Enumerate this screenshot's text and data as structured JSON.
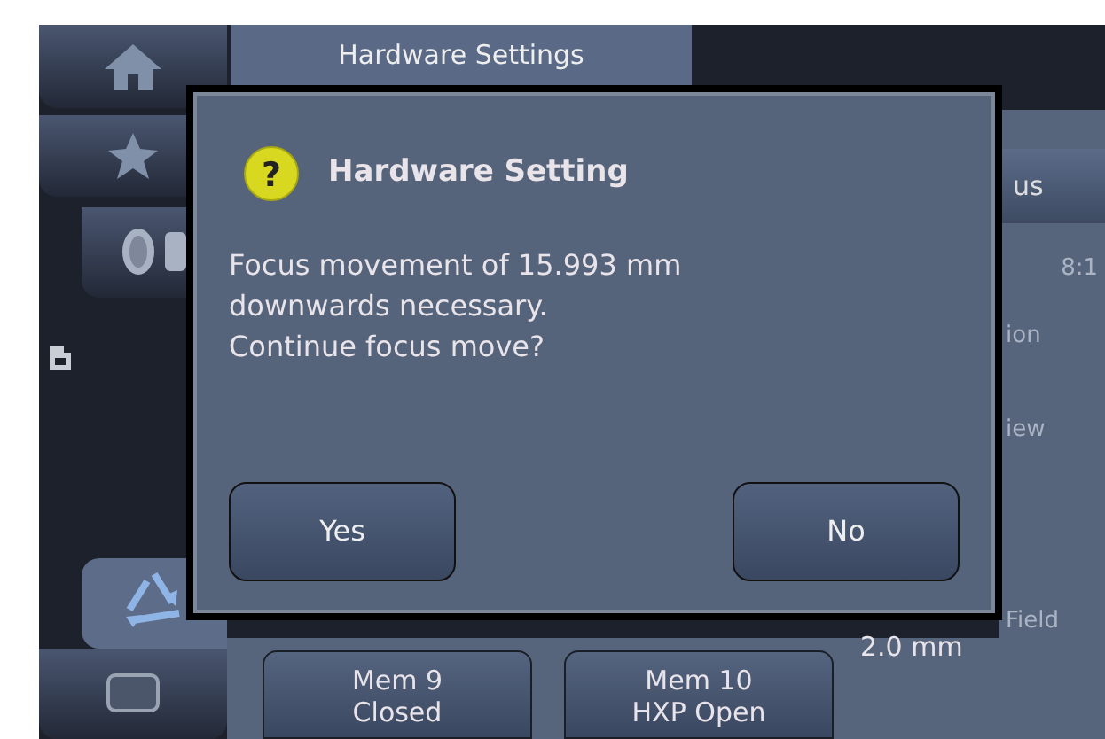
{
  "title_tab": {
    "label": "Hardware Settings",
    "selected": true
  },
  "sidebar": [
    {
      "kind": "home",
      "selected": false
    },
    {
      "kind": "star",
      "selected": false
    },
    {
      "kind": "filter",
      "selected": false
    },
    {
      "kind": "small"
    },
    {
      "kind": "recycle",
      "selected": true
    },
    {
      "kind": "rect",
      "selected": false
    }
  ],
  "right_panel": {
    "button": "us",
    "time": "8:1",
    "labels": [
      "ion",
      "iew",
      "Field"
    ],
    "value": "2.0 mm"
  },
  "memory_buttons": [
    {
      "label": "Mem 9",
      "state": "Closed"
    },
    {
      "label": "Mem 10",
      "state": "HXP Open"
    }
  ],
  "dialog": {
    "icon_glyph": "?",
    "title": "Hardware Setting",
    "message": [
      "Focus movement of 15.993 mm",
      "downwards necessary.",
      "Continue focus move?"
    ],
    "buttons": [
      "Yes",
      "No"
    ]
  }
}
